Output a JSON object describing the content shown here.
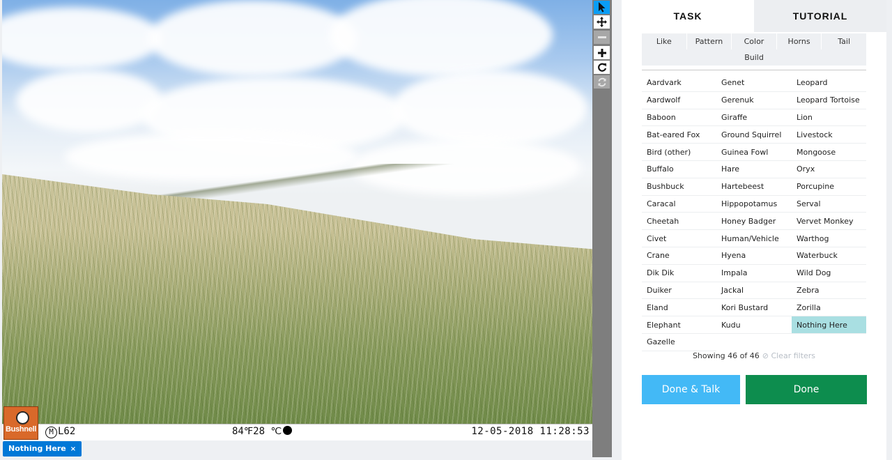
{
  "camera_overlay": {
    "brand": "Bushnell",
    "model": "L62",
    "temperature": "84℉28 ℃",
    "datetime": "12-05-2018 11:28:53"
  },
  "annotation_tag": {
    "label": "Nothing Here",
    "remove": "×"
  },
  "toolbar": {
    "icons": [
      "pointer-icon",
      "move-icon",
      "zoom-out-icon",
      "zoom-in-icon",
      "rotate-icon",
      "reset-icon"
    ]
  },
  "tabs": {
    "task": "TASK",
    "tutorial": "TUTORIAL"
  },
  "filters": {
    "row1": [
      "Like",
      "Pattern",
      "Color",
      "Horns",
      "Tail"
    ],
    "row2": [
      "Build"
    ]
  },
  "species": [
    "Aardvark",
    "Genet",
    "Leopard",
    "Aardwolf",
    "Gerenuk",
    "Leopard Tortoise",
    "Baboon",
    "Giraffe",
    "Lion",
    "Bat-eared Fox",
    "Ground Squirrel",
    "Livestock",
    "Bird (other)",
    "Guinea Fowl",
    "Mongoose",
    "Buffalo",
    "Hare",
    "Oryx",
    "Bushbuck",
    "Hartebeest",
    "Porcupine",
    "Caracal",
    "Hippopotamus",
    "Serval",
    "Cheetah",
    "Honey Badger",
    "Vervet Monkey",
    "Civet",
    "Human/Vehicle",
    "Warthog",
    "Crane",
    "Hyena",
    "Waterbuck",
    "Dik Dik",
    "Impala",
    "Wild Dog",
    "Duiker",
    "Jackal",
    "Zebra",
    "Eland",
    "Kori Bustard",
    "Zorilla",
    "Elephant",
    "Kudu",
    "Nothing Here",
    "Gazelle"
  ],
  "selected_species": "Nothing Here",
  "status": {
    "showing": "Showing 46 of 46",
    "clear_filters": "⊘ Clear filters"
  },
  "buttons": {
    "done_talk": "Done & Talk",
    "done": "Done"
  },
  "colors": {
    "done_talk": "#43b9f6",
    "done": "#0d8d4e",
    "selected": "#a9dfe2",
    "active_tool": "#0a9df5",
    "annotation_tag": "#0078d7"
  }
}
